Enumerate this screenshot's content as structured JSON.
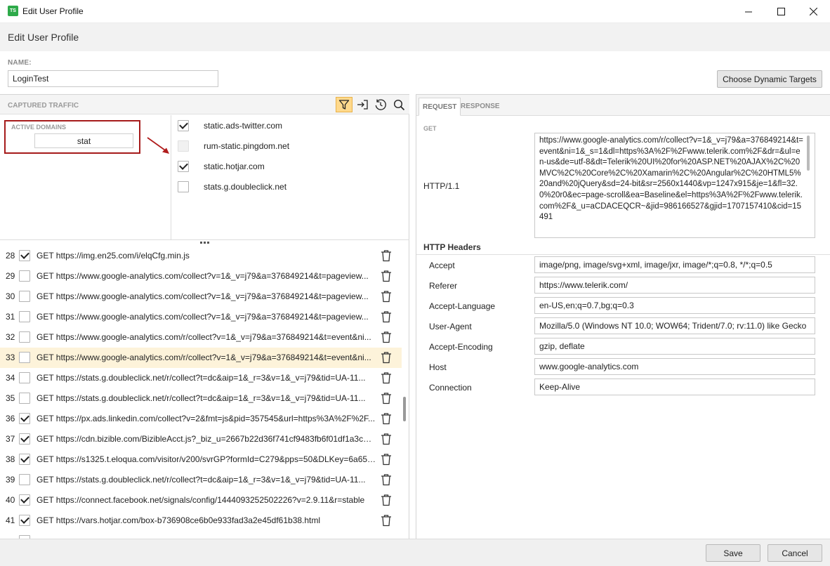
{
  "window": {
    "title": "Edit User Profile",
    "icon_text": "TS"
  },
  "header": {
    "title": "Edit User Profile"
  },
  "name": {
    "label": "NAME:",
    "value": "LoginTest"
  },
  "buttons": {
    "choose_dynamic": "Choose Dynamic Targets",
    "save": "Save",
    "cancel": "Cancel"
  },
  "traffic": {
    "label": "CAPTURED TRAFFIC",
    "active_domains": {
      "label": "ACTIVE DOMAINS",
      "filter": "stat"
    },
    "domains": [
      {
        "name": "static.ads-twitter.com",
        "checked": true
      },
      {
        "name": "rum-static.pingdom.net",
        "checked": false,
        "disabled": true
      },
      {
        "name": "static.hotjar.com",
        "checked": true
      },
      {
        "name": "stats.g.doubleclick.net",
        "checked": false
      }
    ],
    "requests": [
      {
        "num": "28",
        "checked": true,
        "text": "GET https://img.en25.com/i/elqCfg.min.js"
      },
      {
        "num": "29",
        "checked": false,
        "text": "GET https://www.google-analytics.com/collect?v=1&_v=j79&a=376849214&t=pageview..."
      },
      {
        "num": "30",
        "checked": false,
        "text": "GET https://www.google-analytics.com/collect?v=1&_v=j79&a=376849214&t=pageview..."
      },
      {
        "num": "31",
        "checked": false,
        "text": "GET https://www.google-analytics.com/collect?v=1&_v=j79&a=376849214&t=pageview..."
      },
      {
        "num": "32",
        "checked": false,
        "text": "GET https://www.google-analytics.com/r/collect?v=1&_v=j79&a=376849214&t=event&ni..."
      },
      {
        "num": "33",
        "checked": false,
        "selected": true,
        "text": "GET https://www.google-analytics.com/r/collect?v=1&_v=j79&a=376849214&t=event&ni..."
      },
      {
        "num": "34",
        "checked": false,
        "text": "GET https://stats.g.doubleclick.net/r/collect?t=dc&aip=1&_r=3&v=1&_v=j79&tid=UA-11..."
      },
      {
        "num": "35",
        "checked": false,
        "text": "GET https://stats.g.doubleclick.net/r/collect?t=dc&aip=1&_r=3&v=1&_v=j79&tid=UA-11..."
      },
      {
        "num": "36",
        "checked": true,
        "text": "GET https://px.ads.linkedin.com/collect?v=2&fmt=js&pid=357545&url=https%3A%2F%2F..."
      },
      {
        "num": "37",
        "checked": true,
        "text": "GET https://cdn.bizible.com/BizibleAcct.js?_biz_u=2667b22d36f741cf9483fb6f01df1a3c&_..."
      },
      {
        "num": "38",
        "checked": true,
        "text": "GET https://s1325.t.eloqua.com/visitor/v200/svrGP?formId=C279&pps=50&DLKey=6a658..."
      },
      {
        "num": "39",
        "checked": false,
        "text": "GET https://stats.g.doubleclick.net/r/collect?t=dc&aip=1&_r=3&v=1&_v=j79&tid=UA-11..."
      },
      {
        "num": "40",
        "checked": true,
        "text": "GET https://connect.facebook.net/signals/config/1444093252502226?v=2.9.11&r=stable"
      },
      {
        "num": "41",
        "checked": true,
        "text": "GET https://vars.hotjar.com/box-b736908ce6b0e933fad3a2e45df61b38.html"
      }
    ]
  },
  "details": {
    "tabs": {
      "request": "REQUEST",
      "response": "RESPONSE"
    },
    "method": "GET",
    "protocol": "HTTP/1.1",
    "url": "https://www.google-analytics.com/r/collect?v=1&_v=j79&a=376849214&t=event&ni=1&_s=1&dl=https%3A%2F%2Fwww.telerik.com%2F&dr=&ul=en-us&de=utf-8&dt=Telerik%20UI%20for%20ASP.NET%20AJAX%2C%20MVC%2C%20Core%2C%20Xamarin%2C%20Angular%2C%20HTML5%20and%20jQuery&sd=24-bit&sr=2560x1440&vp=1247x915&je=1&fl=32.0%20r0&ec=page-scroll&ea=Baseline&el=https%3A%2F%2Fwww.telerik.com%2F&_u=aCDACEQCR~&jid=986166527&gjid=1707157410&cid=15491",
    "headers_title": "HTTP Headers",
    "headers": [
      {
        "name": "Accept",
        "value": "image/png, image/svg+xml, image/jxr, image/*;q=0.8, */*;q=0.5"
      },
      {
        "name": "Referer",
        "value": "https://www.telerik.com/"
      },
      {
        "name": "Accept-Language",
        "value": "en-US,en;q=0.7,bg;q=0.3"
      },
      {
        "name": "User-Agent",
        "value": "Mozilla/5.0 (Windows NT 10.0; WOW64; Trident/7.0; rv:11.0) like Gecko"
      },
      {
        "name": "Accept-Encoding",
        "value": "gzip, deflate"
      },
      {
        "name": "Host",
        "value": "www.google-analytics.com"
      },
      {
        "name": "Connection",
        "value": "Keep-Alive"
      }
    ]
  },
  "colors": {
    "accent": "#e8b24a",
    "highlight_box": "#a61b1b",
    "selected_row": "#fdf3da",
    "app_icon": "#2eaa4a"
  },
  "icons": {
    "filter": "filter-icon",
    "export": "sign-in-arrow-icon",
    "history": "history-icon",
    "search": "search-icon",
    "delete": "trash-icon"
  }
}
